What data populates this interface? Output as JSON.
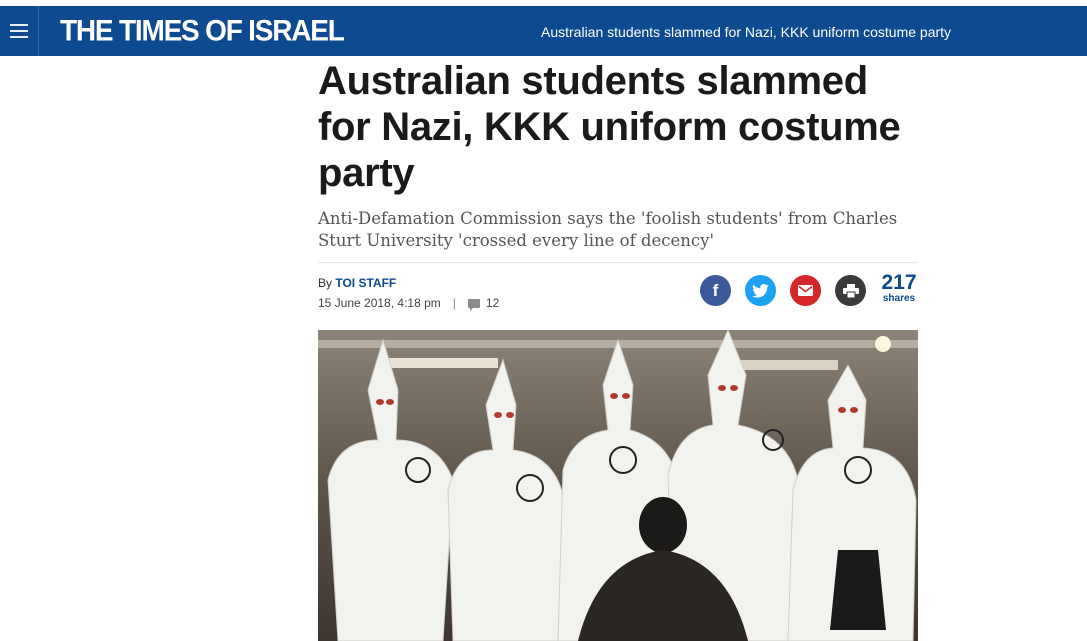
{
  "header": {
    "logo": "THE TIMES OF ISRAEL",
    "headline": "Australian students slammed for Nazi, KKK uniform costume party"
  },
  "article": {
    "title": "Australian students slammed for Nazi, KKK uniform costume party",
    "subtitle": "Anti-Defamation Commission says the 'foolish students' from Charles Sturt University 'crossed every line of decency'",
    "by_label": "By",
    "author": "TOI STAFF",
    "date": "15 June 2018, 4:18 pm",
    "separator": "|",
    "comments": "12"
  },
  "share": {
    "facebook_glyph": "f",
    "count": "217",
    "count_label": "shares"
  },
  "colors": {
    "brand": "#0d4a8f",
    "facebook": "#3b5a99",
    "twitter": "#1da1f2",
    "email": "#d6262b",
    "print": "#3a3a3a"
  }
}
